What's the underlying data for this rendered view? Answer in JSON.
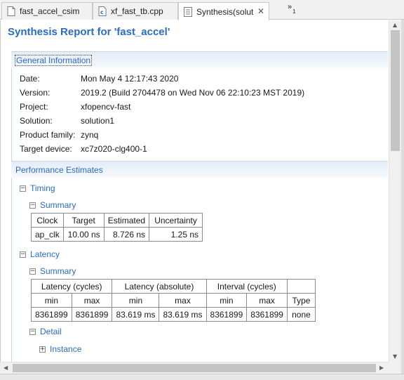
{
  "tabs": [
    {
      "label": "fast_accel_csim",
      "icon": "document-icon"
    },
    {
      "label": "xf_fast_tb.cpp",
      "icon": "c-file-icon"
    },
    {
      "label": "Synthesis(solut",
      "icon": "report-icon",
      "active": true
    }
  ],
  "tab_close_glyph": "✕",
  "overflow": {
    "glyph": "»",
    "count": "1"
  },
  "report_title": "Synthesis Report for 'fast_accel'",
  "general_info": {
    "heading": "General Information",
    "rows": [
      {
        "label": "Date:",
        "value": "Mon May 4 12:17:43 2020"
      },
      {
        "label": "Version:",
        "value": "2019.2 (Build 2704478 on Wed Nov 06 22:10:23 MST 2019)"
      },
      {
        "label": "Project:",
        "value": "xfopencv-fast"
      },
      {
        "label": "Solution:",
        "value": "solution1"
      },
      {
        "label": "Product family:",
        "value": "zynq"
      },
      {
        "label": "Target device:",
        "value": "xc7z020-clg400-1"
      }
    ]
  },
  "performance": {
    "heading": "Performance Estimates",
    "timing": {
      "label": "Timing",
      "summary_label": "Summary",
      "headers": [
        "Clock",
        "Target",
        "Estimated",
        "Uncertainty"
      ],
      "row": [
        "ap_clk",
        "10.00 ns",
        "8.726 ns",
        "1.25 ns"
      ]
    },
    "latency": {
      "label": "Latency",
      "summary_label": "Summary",
      "groups": [
        "Latency (cycles)",
        "Latency (absolute)",
        "Interval (cycles)"
      ],
      "subheaders": [
        "min",
        "max",
        "min",
        "max",
        "min",
        "max",
        "Type"
      ],
      "row": [
        "8361899",
        "8361899",
        "83.619 ms",
        "83.619 ms",
        "8361899",
        "8361899",
        "none"
      ],
      "detail_label": "Detail",
      "instance_label": "Instance"
    }
  },
  "toggle": {
    "expanded": "−",
    "collapsed": "+"
  }
}
